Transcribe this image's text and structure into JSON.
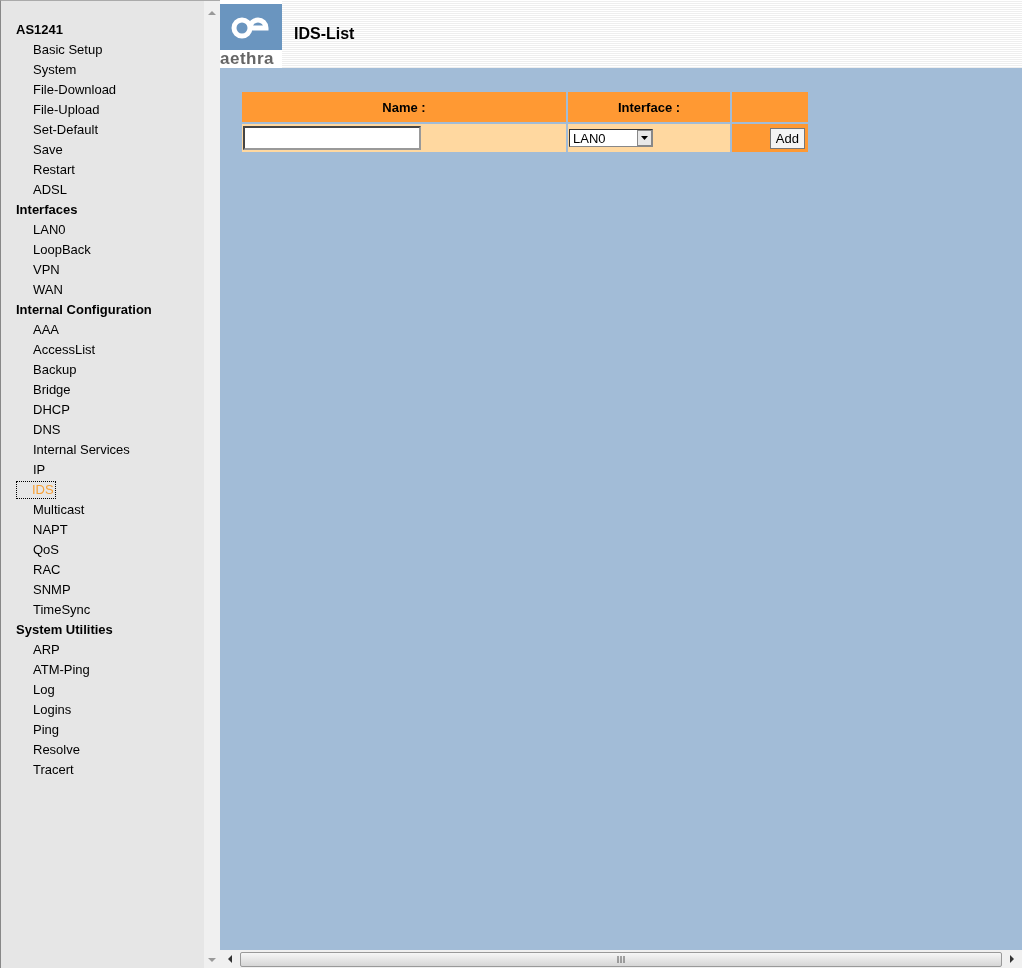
{
  "sidebar": {
    "groups": [
      {
        "title": "AS1241",
        "items": [
          {
            "label": "Basic Setup",
            "selected": false
          },
          {
            "label": "System",
            "selected": false
          },
          {
            "label": "File-Download",
            "selected": false
          },
          {
            "label": "File-Upload",
            "selected": false
          },
          {
            "label": "Set-Default",
            "selected": false
          },
          {
            "label": "Save",
            "selected": false
          },
          {
            "label": "Restart",
            "selected": false
          },
          {
            "label": "ADSL",
            "selected": false
          }
        ]
      },
      {
        "title": "Interfaces",
        "items": [
          {
            "label": "LAN0",
            "selected": false
          },
          {
            "label": "LoopBack",
            "selected": false
          },
          {
            "label": "VPN",
            "selected": false
          },
          {
            "label": "WAN",
            "selected": false
          }
        ]
      },
      {
        "title": "Internal Configuration",
        "items": [
          {
            "label": "AAA",
            "selected": false
          },
          {
            "label": "AccessList",
            "selected": false
          },
          {
            "label": "Backup",
            "selected": false
          },
          {
            "label": "Bridge",
            "selected": false
          },
          {
            "label": "DHCP",
            "selected": false
          },
          {
            "label": "DNS",
            "selected": false
          },
          {
            "label": "Internal Services",
            "selected": false
          },
          {
            "label": "IP",
            "selected": false
          },
          {
            "label": "IDS",
            "selected": true
          },
          {
            "label": "Multicast",
            "selected": false
          },
          {
            "label": "NAPT",
            "selected": false
          },
          {
            "label": "QoS",
            "selected": false
          },
          {
            "label": "RAC",
            "selected": false
          },
          {
            "label": "SNMP",
            "selected": false
          },
          {
            "label": "TimeSync",
            "selected": false
          }
        ]
      },
      {
        "title": "System Utilities",
        "items": [
          {
            "label": "ARP",
            "selected": false
          },
          {
            "label": "ATM-Ping",
            "selected": false
          },
          {
            "label": "Log",
            "selected": false
          },
          {
            "label": "Logins",
            "selected": false
          },
          {
            "label": "Ping",
            "selected": false
          },
          {
            "label": "Resolve",
            "selected": false
          },
          {
            "label": "Tracert",
            "selected": false
          }
        ]
      }
    ]
  },
  "header": {
    "logo_text": "aethra",
    "title": "IDS-List"
  },
  "table": {
    "columns": [
      "Name :",
      "Interface :"
    ],
    "interface_value": "LAN0",
    "add_button": "Add"
  }
}
